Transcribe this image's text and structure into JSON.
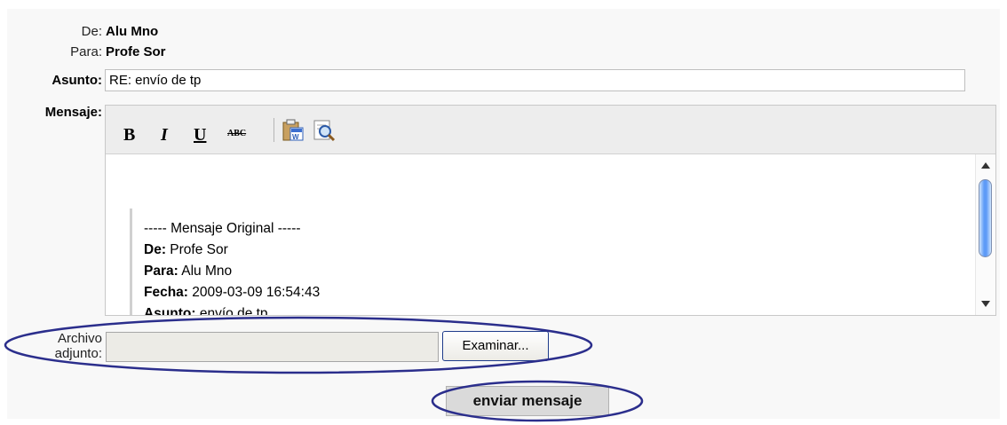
{
  "header": {
    "from_label": "De:",
    "from_value": "Alu Mno",
    "to_label": "Para:",
    "to_value": "Profe Sor",
    "subject_label": "Asunto:",
    "subject_value": "RE: envío de tp",
    "message_label": "Mensaje:"
  },
  "toolbar": {
    "bold": "B",
    "italic": "I",
    "underline": "U",
    "strikethrough": "ABC",
    "icons": [
      "paste-from-word-icon",
      "preview-icon"
    ]
  },
  "message": {
    "separator": "----- Mensaje Original -----",
    "from_label": "De:",
    "from_value": "Profe Sor",
    "to_label": "Para:",
    "to_value": "Alu Mno",
    "date_label": "Fecha:",
    "date_value": "2009-03-09 16:54:43",
    "subject_label": "Asunto:",
    "subject_value": "envío de tp"
  },
  "attachment": {
    "label_line1": "Archivo",
    "label_line2": "adjunto:",
    "browse_label": "Examinar..."
  },
  "actions": {
    "send_label": "enviar mensaje"
  },
  "colors": {
    "annotation": "#2b2e8c",
    "scroll_thumb": "#5e9bf7"
  }
}
